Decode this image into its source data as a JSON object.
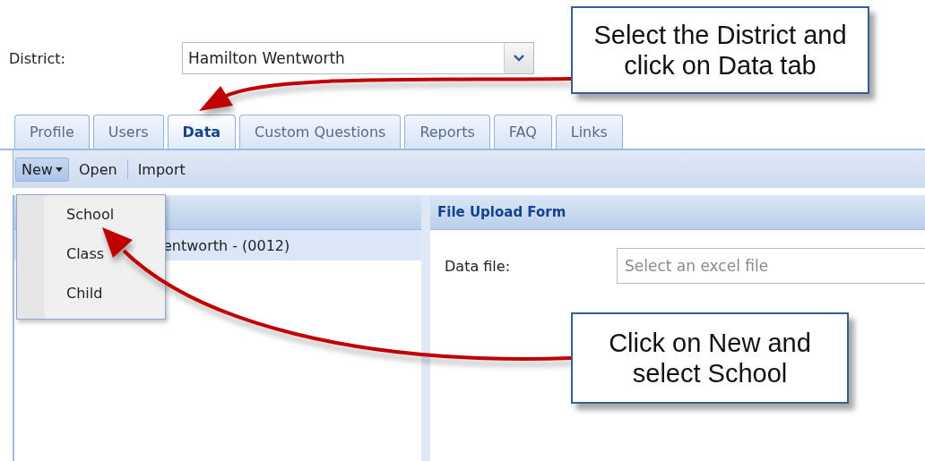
{
  "district": {
    "label": "District:",
    "value": "Hamilton Wentworth"
  },
  "tabs": [
    {
      "label": "Profile",
      "selected": false
    },
    {
      "label": "Users",
      "selected": false
    },
    {
      "label": "Data",
      "selected": true
    },
    {
      "label": "Custom Questions",
      "selected": false
    },
    {
      "label": "Reports",
      "selected": false
    },
    {
      "label": "FAQ",
      "selected": false
    },
    {
      "label": "Links",
      "selected": false
    }
  ],
  "toolbar": [
    {
      "label": "New",
      "kind": "dropdown",
      "expanded": true
    },
    {
      "label": "Open",
      "kind": "button"
    },
    {
      "label": "Import",
      "kind": "button"
    }
  ],
  "menu": [
    {
      "label": "School"
    },
    {
      "label": "Class"
    },
    {
      "label": "Child"
    }
  ],
  "tree": [
    {
      "label": "entworth - (0012)",
      "selected": true
    }
  ],
  "form": {
    "title": "File Upload Form",
    "fields": [
      {
        "label": "Data file:",
        "placeholder": "Select an excel file"
      }
    ]
  },
  "callouts": [
    {
      "text": "Select the District and\nclick on Data tab"
    },
    {
      "text": "Click on New and\nselect School"
    }
  ]
}
